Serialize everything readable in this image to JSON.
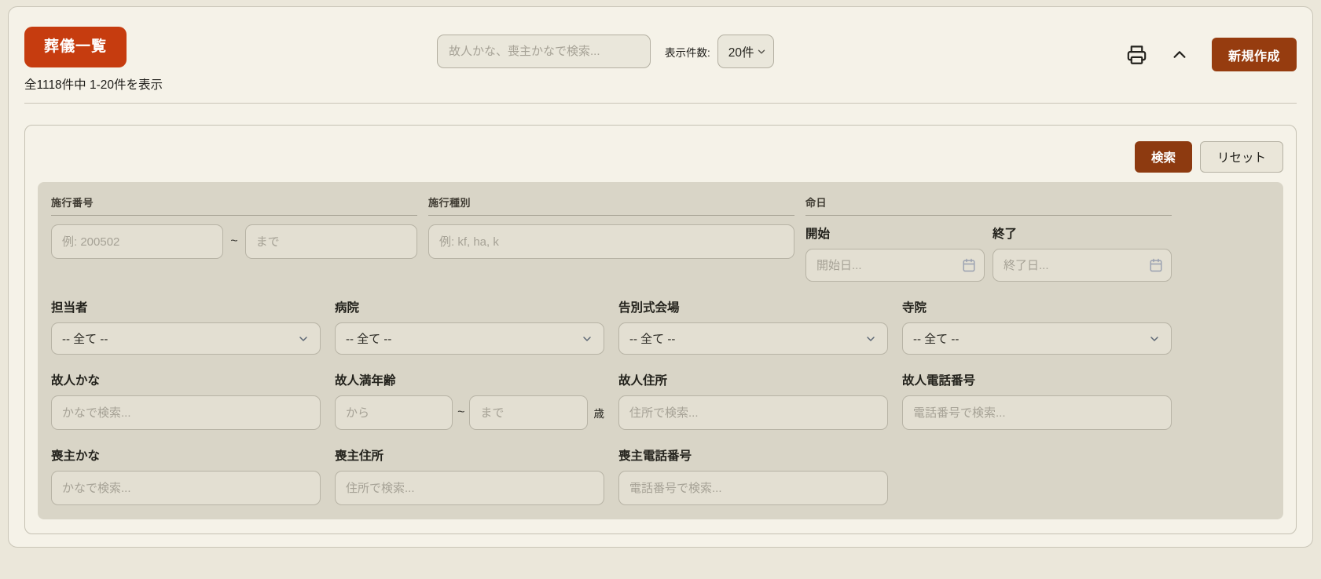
{
  "header": {
    "title": "葬儀一覧",
    "result_summary": "全1118件中 1-20件を表示",
    "search_placeholder": "故人かな、喪主かなで検索...",
    "per_page_label": "表示件数:",
    "per_page_value": "20件",
    "create_button": "新規作成"
  },
  "filter": {
    "search_button": "検索",
    "reset_button": "リセット",
    "number": {
      "legend": "施行番号",
      "from_placeholder": "例: 200502",
      "tilde": "~",
      "to_placeholder": "まで"
    },
    "type": {
      "legend": "施行種別",
      "placeholder": "例: kf, ha, k"
    },
    "death_date": {
      "legend": "命日",
      "start_label": "開始",
      "start_placeholder": "開始日...",
      "end_label": "終了",
      "end_placeholder": "終了日..."
    },
    "selects": [
      {
        "label": "担当者",
        "value": "-- 全て --"
      },
      {
        "label": "病院",
        "value": "-- 全て --"
      },
      {
        "label": "告別式会場",
        "value": "-- 全て --"
      },
      {
        "label": "寺院",
        "value": "-- 全て --"
      }
    ],
    "deceased": {
      "kana": {
        "label": "故人かな",
        "placeholder": "かなで検索..."
      },
      "age": {
        "label": "故人満年齢",
        "from_placeholder": "から",
        "tilde": "~",
        "to_placeholder": "まで",
        "suffix": "歳"
      },
      "address": {
        "label": "故人住所",
        "placeholder": "住所で検索..."
      },
      "phone": {
        "label": "故人電話番号",
        "placeholder": "電話番号で検索..."
      }
    },
    "mourner": {
      "kana": {
        "label": "喪主かな",
        "placeholder": "かなで検索..."
      },
      "address": {
        "label": "喪主住所",
        "placeholder": "住所で検索..."
      },
      "phone": {
        "label": "喪主電話番号",
        "placeholder": "電話番号で検索..."
      }
    }
  },
  "colors": {
    "badge_bg": "#c63c0f",
    "primary_button_bg": "#963c0f",
    "search_button_bg": "#8d3a10",
    "panel_bg": "#d9d5c7",
    "page_bg": "#f5f2e8"
  }
}
